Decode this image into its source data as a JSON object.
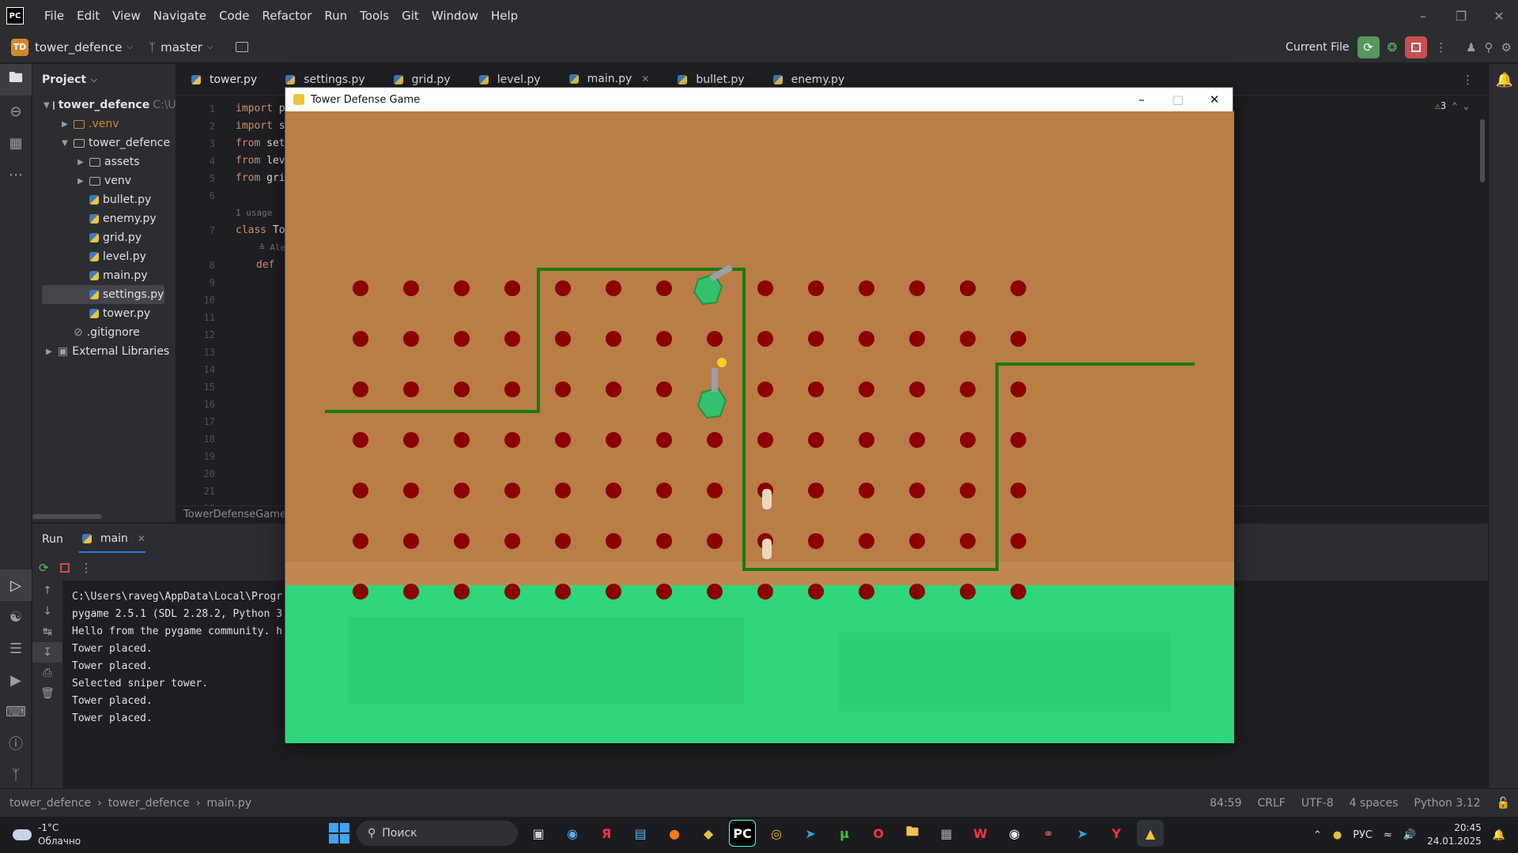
{
  "menu": [
    "File",
    "Edit",
    "View",
    "Navigate",
    "Code",
    "Refactor",
    "Run",
    "Tools",
    "Git",
    "Window",
    "Help"
  ],
  "app_logo": "PC",
  "toolbar": {
    "project_badge": "TD",
    "project_name": "tower_defence",
    "branch": "master",
    "run_config": "Current File"
  },
  "project_panel": {
    "title": "Project",
    "root": "tower_defence",
    "root_path": "C:\\U",
    "items": [
      {
        "label": ".venv",
        "type": "folder"
      },
      {
        "label": "tower_defence",
        "type": "folder"
      },
      {
        "label": "assets",
        "type": "folder"
      },
      {
        "label": "venv",
        "type": "folder"
      },
      {
        "label": "bullet.py",
        "type": "py"
      },
      {
        "label": "enemy.py",
        "type": "py"
      },
      {
        "label": "grid.py",
        "type": "py"
      },
      {
        "label": "level.py",
        "type": "py"
      },
      {
        "label": "main.py",
        "type": "py"
      },
      {
        "label": "settings.py",
        "type": "py"
      },
      {
        "label": "tower.py",
        "type": "py"
      },
      {
        "label": ".gitignore",
        "type": "file"
      },
      {
        "label": "External Libraries",
        "type": "lib"
      }
    ]
  },
  "editor_tabs": [
    "tower.py",
    "settings.py",
    "grid.py",
    "level.py",
    "main.py",
    "bullet.py",
    "enemy.py"
  ],
  "editor": {
    "line_numbers": [
      "1",
      "2",
      "3",
      "4",
      "5",
      "6",
      "",
      "7",
      "",
      "8",
      "9",
      "10",
      "11",
      "12",
      "13",
      "14",
      "15",
      "16",
      "17",
      "18",
      "19",
      "20",
      "21",
      "22"
    ],
    "lines": [
      "import p",
      "import s",
      "from set",
      "from lev",
      "from gri",
      "",
      "1 usage",
      "class To",
      "≙ Ale",
      "def",
      "",
      "",
      "",
      "",
      "",
      "",
      "",
      "",
      "",
      "",
      "",
      "",
      "",
      ""
    ],
    "warnings": "3",
    "breadcrumb": "TowerDefenseGame"
  },
  "run_panel": {
    "title": "Run",
    "tab": "main",
    "console": [
      "C:\\Users\\raveg\\AppData\\Local\\Progr",
      "pygame 2.5.1 (SDL 2.28.2, Python 3",
      "Hello from the pygame community. h",
      "Tower placed.",
      "Tower placed.",
      "Selected sniper tower.",
      "Tower placed.",
      "Tower placed."
    ]
  },
  "statusbar": {
    "crumbs": [
      "tower_defence",
      "tower_defence",
      "main.py"
    ],
    "position": "84:59",
    "line_sep": "CRLF",
    "encoding": "UTF-8",
    "indent": "4 spaces",
    "interpreter": "Python 3.12"
  },
  "game": {
    "title": "Tower Defense Game",
    "colors": {
      "ground": "#b97d46",
      "grass": "#2fd67a",
      "dot": "#8b0000",
      "path": "#1a7a10",
      "tower": "#35c06b"
    }
  },
  "taskbar": {
    "temp": "-1°C",
    "weather": "Облачно",
    "search_placeholder": "Поиск",
    "lang": "РУС",
    "time": "20:45",
    "date": "24.01.2025"
  }
}
